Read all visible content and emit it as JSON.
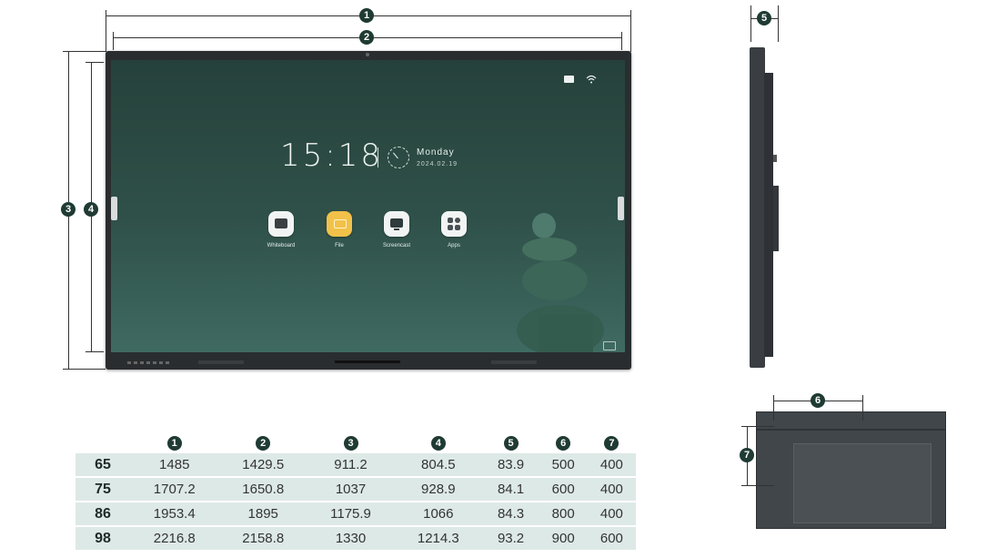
{
  "dimension_markers": [
    "1",
    "2",
    "3",
    "4",
    "5",
    "6",
    "7"
  ],
  "screen": {
    "time": "15:18",
    "day": "Monday",
    "date": "2024.02.19",
    "apps": [
      {
        "label": "Whiteboard",
        "icon": "whiteboard-icon"
      },
      {
        "label": "File",
        "icon": "folder-icon"
      },
      {
        "label": "Screencast",
        "icon": "screencast-icon"
      },
      {
        "label": "Apps",
        "icon": "apps-grid-icon"
      }
    ],
    "status_icons": [
      "screen-mirror-icon",
      "wifi-icon"
    ]
  },
  "table": {
    "headers": [
      "1",
      "2",
      "3",
      "4",
      "5",
      "6",
      "7"
    ],
    "rows": [
      {
        "size": "65",
        "values": [
          "1485",
          "1429.5",
          "911.2",
          "804.5",
          "83.9",
          "500",
          "400"
        ]
      },
      {
        "size": "75",
        "values": [
          "1707.2",
          "1650.8",
          "1037",
          "928.9",
          "84.1",
          "600",
          "400"
        ]
      },
      {
        "size": "86",
        "values": [
          "1953.4",
          "1895",
          "1175.9",
          "1066",
          "84.3",
          "800",
          "400"
        ]
      },
      {
        "size": "98",
        "values": [
          "2216.8",
          "2158.8",
          "1330",
          "1214.3",
          "93.2",
          "900",
          "600"
        ]
      }
    ]
  },
  "colors": {
    "badge": "#1f3b33",
    "row_bg": "#dde9e6",
    "screen_top": "#26413b",
    "screen_bottom": "#3f6a62"
  }
}
